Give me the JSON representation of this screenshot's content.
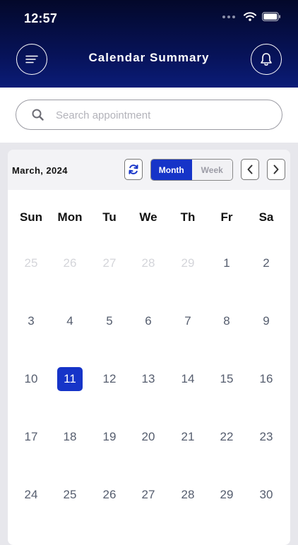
{
  "status_bar": {
    "time": "12:57"
  },
  "header": {
    "title": "Calendar Summary"
  },
  "search": {
    "placeholder": "Search appointment"
  },
  "calendar": {
    "title": "March, 2024",
    "views": {
      "month": "Month",
      "week": "Week",
      "active": "Month"
    },
    "weekdays": [
      "Sun",
      "Mon",
      "Tu",
      "We",
      "Th",
      "Fr",
      "Sa"
    ],
    "weeks": [
      [
        "25",
        "26",
        "27",
        "28",
        "29",
        "1",
        "2"
      ],
      [
        "3",
        "4",
        "5",
        "6",
        "7",
        "8",
        "9"
      ],
      [
        "10",
        "11",
        "12",
        "13",
        "14",
        "15",
        "16"
      ],
      [
        "17",
        "18",
        "19",
        "20",
        "21",
        "22",
        "23"
      ],
      [
        "24",
        "25",
        "26",
        "27",
        "28",
        "29",
        "30"
      ]
    ],
    "previous_month_days": [
      "25",
      "26",
      "27",
      "28",
      "29"
    ],
    "selected_day": "11"
  },
  "colors": {
    "header_dark": "#03082a",
    "header_blue": "#0b1c78",
    "accent": "#1634c8",
    "muted_day": "#d4d5da",
    "day_text": "#555d6e"
  },
  "icons": {
    "menu": "hamburger-menu-icon",
    "notification": "bell-icon",
    "search": "search-icon",
    "refresh": "refresh-icon",
    "prev": "chevron-left-icon",
    "next": "chevron-right-icon"
  }
}
